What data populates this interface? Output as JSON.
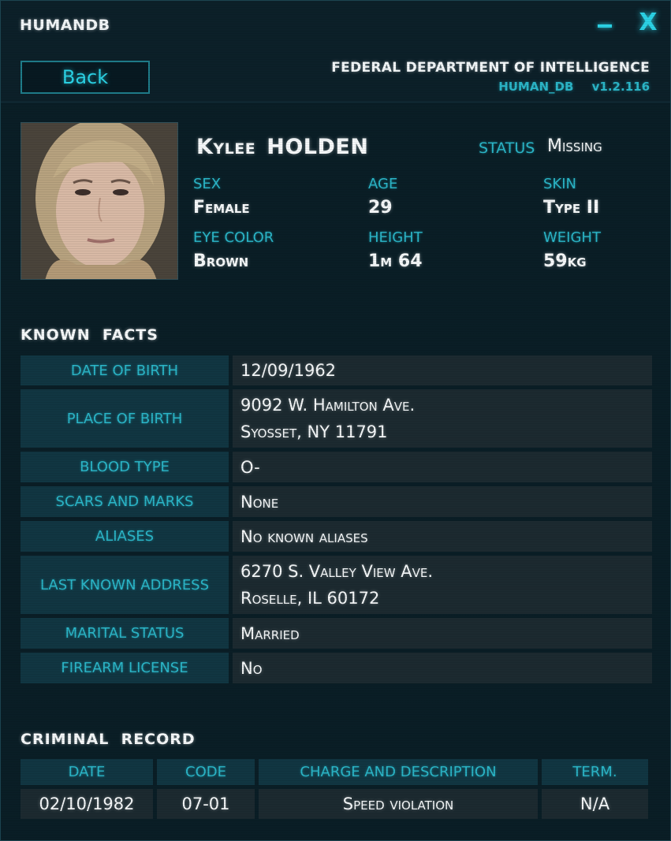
{
  "window": {
    "title": "HUMANDB",
    "minimize_label": "",
    "close_label": "X"
  },
  "header": {
    "back_label": "Back",
    "agency": "FEDERAL DEPARTMENT OF INTELLIGENCE",
    "db_name": "HUMAN_DB",
    "version": "v1.2.116"
  },
  "profile": {
    "first_name": "Kylee",
    "last_name": "HOLDEN",
    "status_label": "STATUS",
    "status_value": "Missing",
    "attributes": [
      {
        "label": "SEX",
        "value": "Female"
      },
      {
        "label": "AGE",
        "value": "29"
      },
      {
        "label": "SKIN",
        "value": "Type II"
      },
      {
        "label": "EYE COLOR",
        "value": "Brown"
      },
      {
        "label": "HEIGHT",
        "value": "1m 64"
      },
      {
        "label": "WEIGHT",
        "value": "59kg"
      }
    ]
  },
  "known_facts": {
    "title": "KNOWN  FACTS",
    "rows": [
      {
        "key": "DATE OF BIRTH",
        "lines": [
          "12/09/1962"
        ]
      },
      {
        "key": "PLACE OF BIRTH",
        "lines": [
          "9092 W. Hamilton Ave.",
          "Syosset, NY 11791"
        ]
      },
      {
        "key": "BLOOD TYPE",
        "lines": [
          "O-"
        ]
      },
      {
        "key": "SCARS AND MARKS",
        "lines": [
          "None"
        ]
      },
      {
        "key": "ALIASES",
        "lines": [
          "No known aliases"
        ]
      },
      {
        "key": "LAST KNOWN ADDRESS",
        "lines": [
          "6270 S. Valley View Ave.",
          "Roselle, IL 60172"
        ]
      },
      {
        "key": "MARITAL STATUS",
        "lines": [
          "Married"
        ]
      },
      {
        "key": "FIREARM LICENSE",
        "lines": [
          "No"
        ]
      }
    ]
  },
  "criminal_record": {
    "title": "CRIMINAL  RECORD",
    "columns": [
      "DATE",
      "CODE",
      "CHARGE AND DESCRIPTION",
      "TERM."
    ],
    "rows": [
      [
        "02/10/1982",
        "07-01",
        "Speed violation",
        "N/A"
      ]
    ]
  },
  "colors": {
    "background": "#0a1e26",
    "accent": "#2bd3e6",
    "label": "#2bb6c8",
    "key_cell": "#113642",
    "value_cell": "#1c2a30"
  },
  "icons": {
    "minimize": "minimize-icon",
    "close": "close-icon"
  }
}
